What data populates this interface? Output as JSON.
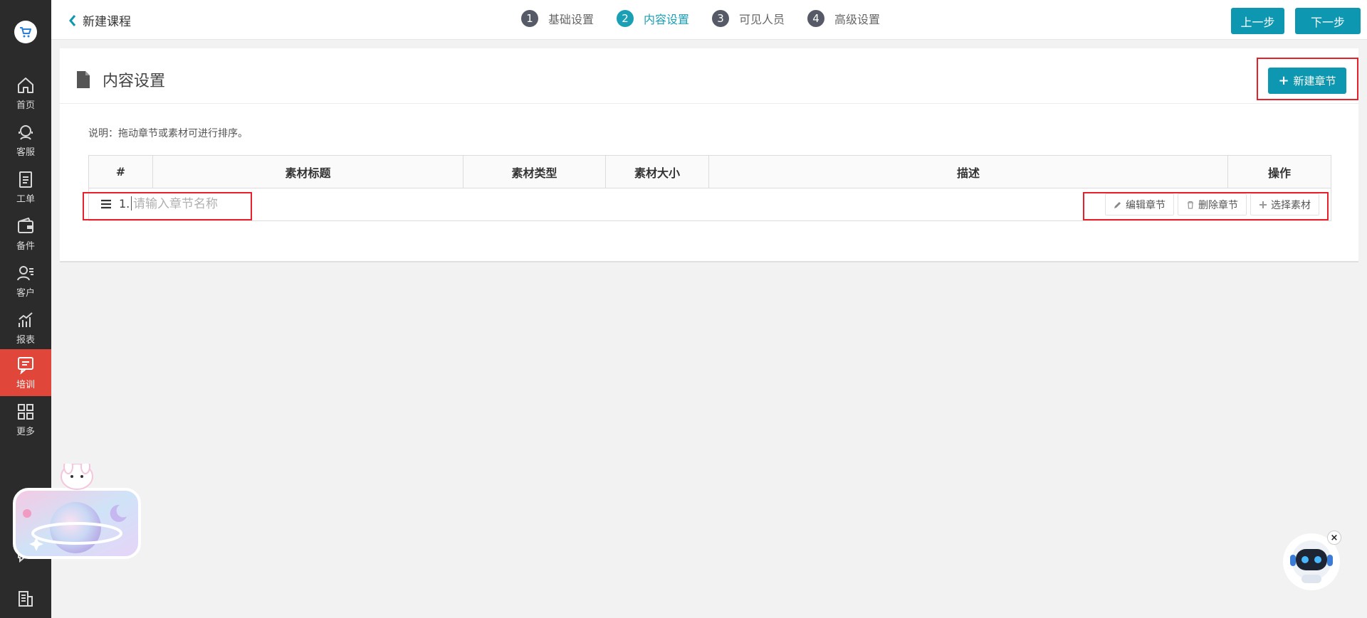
{
  "sidebar": {
    "logo_icon": "cart-icon",
    "items": [
      {
        "label": "首页",
        "icon": "home-icon"
      },
      {
        "label": "客服",
        "icon": "headset-icon"
      },
      {
        "label": "工单",
        "icon": "clipboard-icon"
      },
      {
        "label": "备件",
        "icon": "wallet-icon"
      },
      {
        "label": "客户",
        "icon": "user-list-icon"
      },
      {
        "label": "报表",
        "icon": "chart-icon"
      },
      {
        "label": "培训",
        "icon": "chat-board-icon",
        "active": true
      },
      {
        "label": "更多",
        "icon": "grid-icon"
      }
    ]
  },
  "header": {
    "back_label": "新建课程",
    "steps": [
      {
        "num": "1",
        "label": "基础设置"
      },
      {
        "num": "2",
        "label": "内容设置",
        "active": true
      },
      {
        "num": "3",
        "label": "可见人员"
      },
      {
        "num": "4",
        "label": "高级设置"
      }
    ],
    "prev_label": "上一步",
    "next_label": "下一步"
  },
  "panel": {
    "title": "内容设置",
    "new_chapter_label": "新建章节",
    "note": "说明：拖动章节或素材可进行排序。"
  },
  "table": {
    "columns": [
      "#",
      "素材标题",
      "素材类型",
      "素材大小",
      "描述",
      "操作"
    ],
    "rows": [
      {
        "index": "1.",
        "placeholder": "请输入章节名称",
        "actions": [
          "编辑章节",
          "删除章节",
          "选择素材"
        ]
      }
    ]
  },
  "colors": {
    "accent": "#0e97b0",
    "sidebar_bg": "#2b2b2b",
    "sidebar_active": "#e0473a",
    "highlight_box": "#e8202a"
  }
}
